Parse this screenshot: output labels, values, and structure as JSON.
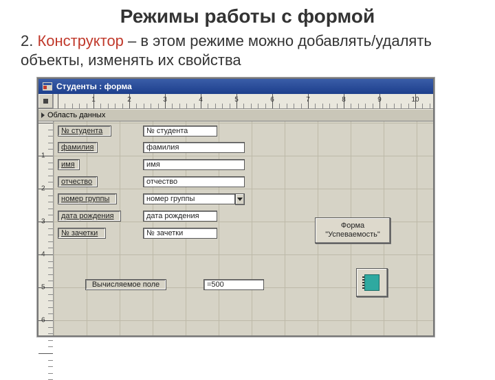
{
  "page": {
    "title": "Режимы работы с формой",
    "desc_num": "2.",
    "desc_keyword": "Конструктор",
    "desc_rest": " – в этом режиме можно добавлять/удалять объекты, изменять их свойства"
  },
  "window": {
    "title": "Студенты : форма",
    "section_header": "Область данных"
  },
  "ruler_h": {
    "marks": [
      1,
      2,
      3,
      4,
      5,
      6,
      7,
      8,
      9,
      10
    ]
  },
  "ruler_v": {
    "marks": [
      1,
      2,
      3,
      4,
      5,
      6
    ]
  },
  "labels": {
    "student_no": "№ студента",
    "lastname": "фамилия",
    "firstname": "имя",
    "patronymic": "отчество",
    "group_no": "номер группы",
    "birthdate": "дата рождения",
    "recordbook_no": "№ зачетки",
    "calc_field": "Вычисляемое поле"
  },
  "fields": {
    "student_no": "№ студента",
    "lastname": "фамилия",
    "firstname": "имя",
    "patronymic": "отчество",
    "group_no": "номер группы",
    "birthdate": "дата рождения",
    "recordbook_no": "№ зачетки",
    "calc_expr": "=500"
  },
  "buttons": {
    "form_button_line1": "Форма",
    "form_button_line2": "\"Успеваемость\""
  }
}
